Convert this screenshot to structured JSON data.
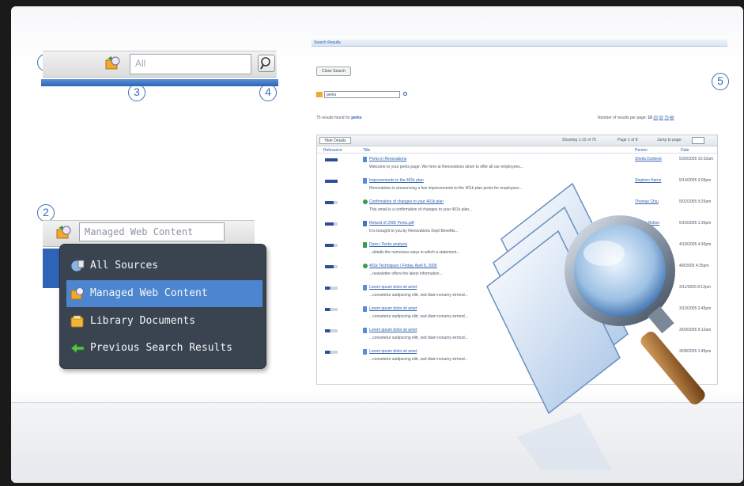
{
  "callouts": [
    "1",
    "2",
    "3",
    "4",
    "5"
  ],
  "simple_search": {
    "scope_value": "All",
    "search_button_icon": "magnifier-icon"
  },
  "scope_picker": {
    "selected_value": "Managed Web Content",
    "options": [
      {
        "label": "All Sources",
        "icon": "globe-icon"
      },
      {
        "label": "Managed Web Content",
        "icon": "web-content-icon",
        "selected": true
      },
      {
        "label": "Library Documents",
        "icon": "library-icon"
      },
      {
        "label": "Previous Search Results",
        "icon": "back-arrow-icon"
      }
    ]
  },
  "results_page": {
    "title": "Search Results",
    "close_button": "Close Search",
    "query": "perks",
    "summary_prefix": "75 results found for",
    "summary_query": "perks",
    "per_page_label": "Number of results per page:",
    "per_page_options": [
      "10",
      "25",
      "50",
      "75",
      "All"
    ],
    "hide_details": "Hide Details",
    "paging": "Showing 1-10 of 75",
    "page_of": "Page 1 of 8",
    "jump_label": "Jump to page:",
    "columns": [
      "Relevance",
      "Title",
      "Person",
      "Date"
    ],
    "rows": [
      {
        "relevance": 1.0,
        "title": "Perks in Renovations",
        "snippet": "Welcome to your perks page. We here at Renovations strive to offer all our employees...",
        "person": "Sheila Durbeck",
        "date": "5/30/2005 10:02am",
        "icon": "document-icon"
      },
      {
        "relevance": 1.0,
        "title": "Improvements to the 401k plan",
        "snippet": "Renovations is announcing a few improvements to the 401k plan perks for employees...",
        "person": "Stephen Harris",
        "date": "5/14/2005 3:05pm",
        "icon": "document-icon"
      },
      {
        "relevance": 0.7,
        "title": "Confirmation of changes to your 401k plan",
        "snippet": "This email is a confirmation of changes to your 401k plan...",
        "person": "Thomas Chiu",
        "date": "5/02/2005 9:25am",
        "icon": "email-icon"
      },
      {
        "relevance": 0.7,
        "title": "Refund of 2005 Perks.pdf",
        "snippet": "It is brought to you by Renovations Dept Benefits...",
        "person": "Dennis Bolton",
        "date": "5/16/2005 1:30pm",
        "icon": "pdf-icon"
      },
      {
        "relevance": 0.7,
        "title": "Dues / Perks analysis",
        "snippet": "...details the numerous ways in which a statement...",
        "person": "",
        "date": "4/18/2005 4:30pm",
        "icon": "spreadsheet-icon"
      },
      {
        "relevance": 0.7,
        "title": "401k Techniques / Friday, April 8, 2005",
        "snippet": "...newsletter offers the latest information...",
        "person": "",
        "date": "4/8/2005 4:25pm",
        "icon": "email-icon"
      },
      {
        "relevance": 0.4,
        "title": "Lorem ipsum dolor sit amet",
        "snippet": "...consetetur sadipscing elitr, sed diam nonumy eirmod...",
        "person": "",
        "date": "3/11/2005 8:12pm",
        "icon": "document-icon"
      },
      {
        "relevance": 0.4,
        "title": "Lorem ipsum dolor sit amet",
        "snippet": "...consetetur sadipscing elitr, sed diam nonumy eirmod...",
        "person": "",
        "date": "3/10/2005 2:45pm",
        "icon": "document-icon"
      },
      {
        "relevance": 0.4,
        "title": "Lorem ipsum dolor sit amet",
        "snippet": "...consetetur sadipscing elitr, sed diam nonumy eirmod...",
        "person": "",
        "date": "3/09/2005 9:12am",
        "icon": "document-icon"
      },
      {
        "relevance": 0.4,
        "title": "Lorem ipsum dolor sit amet",
        "snippet": "...consetetur sadipscing elitr, sed diam nonumy eirmod...",
        "person": "",
        "date": "3/08/2005 1:45pm",
        "icon": "document-icon"
      }
    ],
    "illustration_icon": "magnifying-glass-over-documents-icon"
  },
  "colors": {
    "accent_blue": "#2d64b8",
    "dropdown_bg": "#3a4450",
    "dropdown_selected": "#4c86d0",
    "callout_blue": "#3a6fb5"
  }
}
